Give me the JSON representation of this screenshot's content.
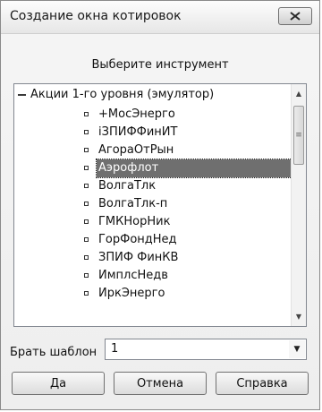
{
  "window": {
    "title": "Создание окна котировок"
  },
  "prompt": "Выберите инструмент",
  "list": {
    "root_label": "Акции 1-го уровня (эмулятор)",
    "items": [
      {
        "label": "+МосЭнерго",
        "selected": false
      },
      {
        "label": "iЗПИФФинИТ",
        "selected": false
      },
      {
        "label": "АгораОтРын",
        "selected": false
      },
      {
        "label": "Аэрофлот",
        "selected": true
      },
      {
        "label": "ВолгаТлк",
        "selected": false
      },
      {
        "label": "ВолгаТлк-п",
        "selected": false
      },
      {
        "label": "ГМКНорНик",
        "selected": false
      },
      {
        "label": "ГорФондНед",
        "selected": false
      },
      {
        "label": "ЗПИФ ФинКВ",
        "selected": false
      },
      {
        "label": "ИмплсНедв",
        "selected": false
      },
      {
        "label": "ИркЭнерго",
        "selected": false
      }
    ]
  },
  "template": {
    "label": "Брать шаблон",
    "value": "1"
  },
  "buttons": {
    "ok": "Да",
    "cancel": "Отмена",
    "help": "Справка"
  },
  "icons": {
    "close": "close-icon",
    "scroll_up": "arrow-up-icon",
    "scroll_down": "arrow-down-icon",
    "dropdown": "chevron-down-icon"
  },
  "colors": {
    "selection": "#6f6f6f"
  }
}
